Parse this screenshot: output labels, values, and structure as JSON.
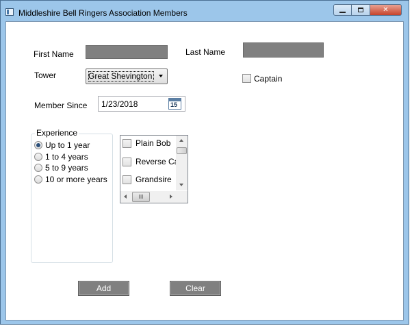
{
  "window": {
    "title": "Middleshire Bell Ringers Association Members",
    "icon": "app-window-icon",
    "controls": {
      "minimize": "minimize-icon",
      "maximize": "maximize-icon",
      "close": "close-icon"
    }
  },
  "form": {
    "first_name_label": "First Name",
    "first_name_value": "",
    "last_name_label": "Last Name",
    "last_name_value": "",
    "tower_label": "Tower",
    "tower_selected": "Great Shevington",
    "captain_label": "Captain",
    "captain_checked": false,
    "member_since_label": "Member Since",
    "member_since_value": "1/23/2018",
    "calendar_icon_day": "15"
  },
  "experience": {
    "header": "Experience",
    "options": [
      {
        "label": "Up to 1 year",
        "checked": true
      },
      {
        "label": "1 to 4 years",
        "checked": false
      },
      {
        "label": "5 to 9 years",
        "checked": false
      },
      {
        "label": "10 or more years",
        "checked": false
      }
    ]
  },
  "methods": {
    "items": [
      {
        "label": "Plain Bob",
        "checked": false
      },
      {
        "label": "Reverse Canterbury",
        "checked": false
      },
      {
        "label": "Grandsire",
        "checked": false
      }
    ],
    "hthumb_glyph": "III"
  },
  "buttons": {
    "add_label": "Add",
    "clear_label": "Clear"
  },
  "colors": {
    "title_bar": "#9cc6ea",
    "input_fill": "#808080",
    "button_fill": "#808080",
    "radio_dot": "#2b4f7a"
  }
}
